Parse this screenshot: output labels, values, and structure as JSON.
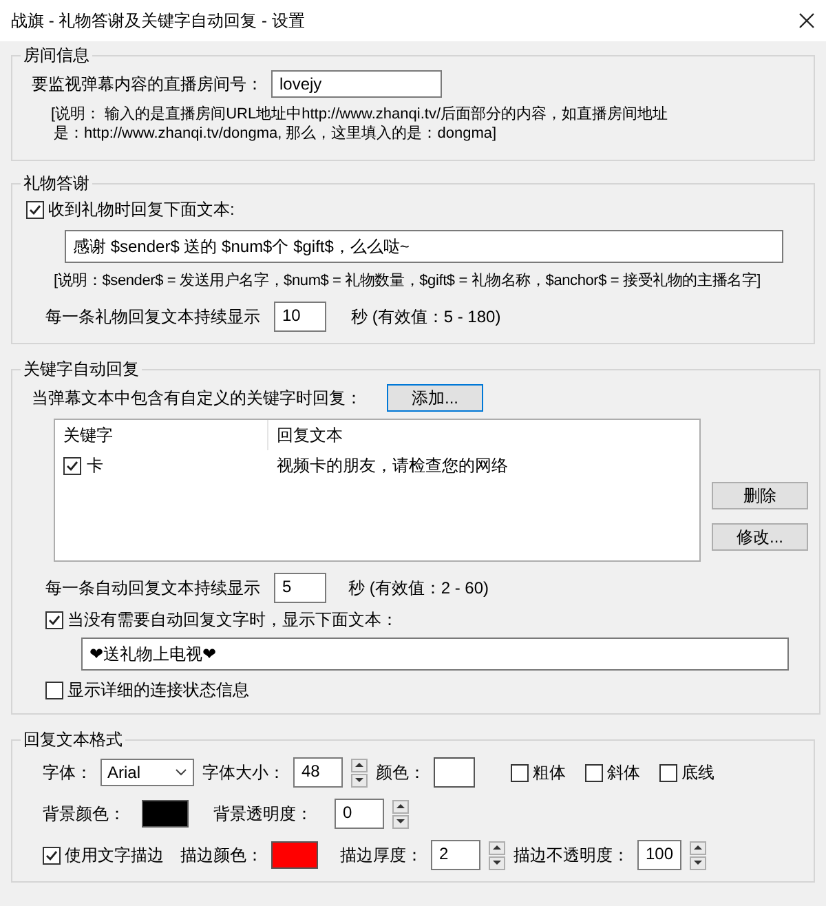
{
  "window": {
    "title": "战旗 - 礼物答谢及关键字自动回复 - 设置"
  },
  "room": {
    "title": "房间信息",
    "room_label": "要监视弹幕内容的直播房间号：",
    "room_value": "lovejy",
    "note_lines": [
      "[说明： 输入的是直播房间URL地址中http://www.zhanqi.tv/后面部分的内容，如直播房间地址",
      "是：http://www.zhanqi.tv/dongma, 那么，这里填入的是：dongma]"
    ]
  },
  "gift": {
    "title": "礼物答谢",
    "reply_enabled": {
      "label": "收到礼物时回复下面文本:",
      "checked": true
    },
    "reply_text": "感谢 $sender$ 送的 $num$个 $gift$，么么哒~",
    "note": "[说明：$sender$ = 发送用户名字，$num$ = 礼物数量，$gift$ = 礼物名称，$anchor$ = 接受礼物的主播名字]",
    "duration_label": "每一条礼物回复文本持续显示",
    "duration_value": "10",
    "duration_hint": "秒 (有效值：5 - 180)"
  },
  "keyword": {
    "title": "关键字自动回复",
    "intro": "当弹幕文本中包含有自定义的关键字时回复：",
    "add_button": "添加...",
    "columns": [
      "关键字",
      "回复文本"
    ],
    "rows": [
      {
        "keyword": "卡",
        "reply": "视频卡的朋友，请检查您的网络",
        "checked": true
      }
    ],
    "delete_button": "删除",
    "edit_button": "修改...",
    "duration_label": "每一条自动回复文本持续显示",
    "duration_value": "5",
    "duration_hint": "秒 (有效值：2 - 60)",
    "idle": {
      "label": "当没有需要自动回复文字时，显示下面文本：",
      "checked": true
    },
    "idle_text": "❤送礼物上电视❤",
    "verbose": {
      "label": "显示详细的连接状态信息",
      "checked": false
    }
  },
  "format": {
    "title": "回复文本格式",
    "font_label": "字体：",
    "font_value": "Arial",
    "size_label": "字体大小：",
    "size_value": "48",
    "color_label": "颜色：",
    "text_swatch": {
      "color": "#ffffff"
    },
    "styles": [
      {
        "label": "粗体",
        "checked": false
      },
      {
        "label": "斜体",
        "checked": false
      },
      {
        "label": "底线",
        "checked": false
      }
    ],
    "bg_color_label": "背景颜色：",
    "bg_swatch": {
      "color": "#000000"
    },
    "bg_opacity_label": "背景透明度：",
    "bg_opacity_value": "0",
    "outline": {
      "label": "使用文字描边",
      "checked": true
    },
    "outline_color_label": "描边颜色：",
    "outline_swatch": {
      "color": "#ff0000"
    },
    "outline_width_label": "描边厚度：",
    "outline_width_value": "2",
    "outline_opacity_label": "描边不透明度：",
    "outline_opacity_value": "100"
  }
}
